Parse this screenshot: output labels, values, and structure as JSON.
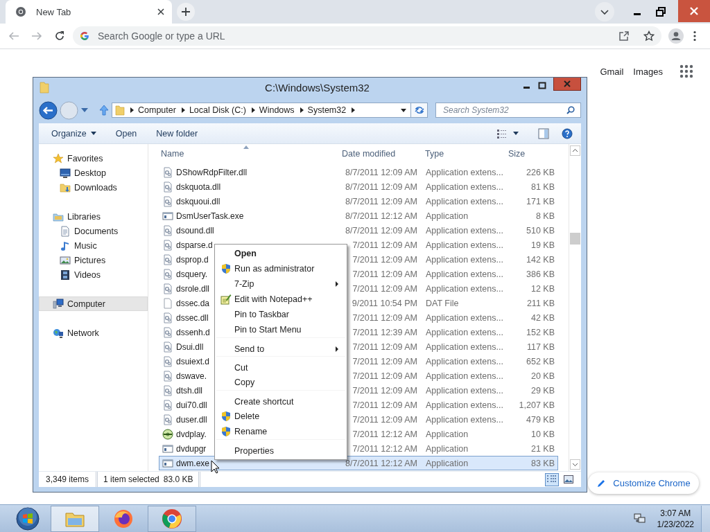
{
  "browser": {
    "tab": {
      "title": "New Tab"
    },
    "address_bar": {
      "placeholder": "Search Google or type a URL"
    },
    "links": [
      "Gmail",
      "Images"
    ],
    "customize_button": "Customize Chrome"
  },
  "explorer": {
    "title": "C:\\Windows\\System32",
    "breadcrumb": [
      "Computer",
      "Local Disk (C:)",
      "Windows",
      "System32"
    ],
    "search": {
      "placeholder": "Search System32"
    },
    "commands": [
      {
        "label": "Organize",
        "kind": "menu"
      },
      {
        "label": "Open",
        "kind": "plain"
      },
      {
        "label": "New folder",
        "kind": "plain"
      }
    ],
    "navigation": [
      {
        "label": "Favorites",
        "kind": "star",
        "selected": false,
        "children": [
          {
            "label": "Desktop",
            "kind": "desktop",
            "selected": false
          },
          {
            "label": "Downloads",
            "kind": "downloads",
            "selected": false
          }
        ]
      },
      {
        "label": "Libraries",
        "kind": "libraries",
        "selected": false,
        "children": [
          {
            "label": "Documents",
            "kind": "documents",
            "selected": false
          },
          {
            "label": "Music",
            "kind": "music",
            "selected": false
          },
          {
            "label": "Pictures",
            "kind": "pictures",
            "selected": false
          },
          {
            "label": "Videos",
            "kind": "videos",
            "selected": false
          }
        ]
      },
      {
        "label": "Computer",
        "kind": "computer",
        "selected": true
      },
      {
        "label": "Network",
        "kind": "network",
        "selected": false
      }
    ],
    "columns": [
      {
        "label": "Name",
        "sorted": true
      },
      {
        "label": "Date modified",
        "sorted": false
      },
      {
        "label": "Type",
        "sorted": false
      },
      {
        "label": "Size",
        "sorted": false
      }
    ],
    "files": [
      {
        "name": "DShowRdpFilter.dll",
        "date": "8/7/2011 12:09 AM",
        "type": "Application extens...",
        "size": "226 KB",
        "kind": "dll",
        "selected": false
      },
      {
        "name": "dskquota.dll",
        "date": "8/7/2011 12:09 AM",
        "type": "Application extens...",
        "size": "81 KB",
        "kind": "dll",
        "selected": false
      },
      {
        "name": "dskquoui.dll",
        "date": "8/7/2011 12:09 AM",
        "type": "Application extens...",
        "size": "171 KB",
        "kind": "dll",
        "selected": false
      },
      {
        "name": "DsmUserTask.exe",
        "date": "8/7/2011 12:12 AM",
        "type": "Application",
        "size": "8 KB",
        "kind": "exe",
        "selected": false
      },
      {
        "name": "dsound.dll",
        "date": "8/7/2011 12:09 AM",
        "type": "Application extens...",
        "size": "510 KB",
        "kind": "dll",
        "selected": false
      },
      {
        "name": "dsparse.d",
        "date": "7/2011 12:09 AM",
        "type": "Application extens...",
        "size": "19 KB",
        "kind": "dll",
        "selected": false
      },
      {
        "name": "dsprop.d",
        "date": "7/2011 12:09 AM",
        "type": "Application extens...",
        "size": "142 KB",
        "kind": "dll",
        "selected": false
      },
      {
        "name": "dsquery.",
        "date": "7/2011 12:09 AM",
        "type": "Application extens...",
        "size": "386 KB",
        "kind": "dll",
        "selected": false
      },
      {
        "name": "dsrole.dll",
        "date": "7/2011 12:09 AM",
        "type": "Application extens...",
        "size": "12 KB",
        "kind": "dll",
        "selected": false
      },
      {
        "name": "dssec.da",
        "date": "9/2011 10:54 PM",
        "type": "DAT File",
        "size": "211 KB",
        "kind": "dat",
        "selected": false
      },
      {
        "name": "dssec.dll",
        "date": "7/2011 12:09 AM",
        "type": "Application extens...",
        "size": "42 KB",
        "kind": "dll",
        "selected": false
      },
      {
        "name": "dssenh.d",
        "date": "7/2011 12:39 AM",
        "type": "Application extens...",
        "size": "152 KB",
        "kind": "dll",
        "selected": false
      },
      {
        "name": "Dsui.dll",
        "date": "7/2011 12:09 AM",
        "type": "Application extens...",
        "size": "117 KB",
        "kind": "dll",
        "selected": false
      },
      {
        "name": "dsuiext.d",
        "date": "7/2011 12:09 AM",
        "type": "Application extens...",
        "size": "652 KB",
        "kind": "dll",
        "selected": false
      },
      {
        "name": "dswave.",
        "date": "7/2011 12:09 AM",
        "type": "Application extens...",
        "size": "20 KB",
        "kind": "dll",
        "selected": false
      },
      {
        "name": "dtsh.dll",
        "date": "7/2011 12:09 AM",
        "type": "Application extens...",
        "size": "29 KB",
        "kind": "dll",
        "selected": false
      },
      {
        "name": "dui70.dll",
        "date": "7/2011 12:09 AM",
        "type": "Application extens...",
        "size": "1,207 KB",
        "kind": "dll",
        "selected": false
      },
      {
        "name": "duser.dll",
        "date": "7/2011 12:09 AM",
        "type": "Application extens...",
        "size": "479 KB",
        "kind": "dll",
        "selected": false
      },
      {
        "name": "dvdplay.",
        "date": "7/2011 12:12 AM",
        "type": "Application",
        "size": "10 KB",
        "kind": "dvd",
        "selected": false
      },
      {
        "name": "dvdupgr",
        "date": "7/2011 12:12 AM",
        "type": "Application",
        "size": "21 KB",
        "kind": "exe",
        "selected": false
      },
      {
        "name": "dwm.exe",
        "date": "8/7/2011 12:12 AM",
        "type": "Application",
        "size": "83 KB",
        "kind": "exe",
        "selected": true
      }
    ],
    "status": {
      "count": "3,349 items",
      "selection": "1 item selected",
      "selection_size": "83.0 KB"
    }
  },
  "context_menu": [
    {
      "label": "Open",
      "kind": "default",
      "submenu": false,
      "separator_before": false
    },
    {
      "label": "Run as administrator",
      "kind": "admin",
      "submenu": false,
      "separator_before": false
    },
    {
      "label": "7-Zip",
      "kind": "plain",
      "submenu": true,
      "separator_before": false
    },
    {
      "label": "Edit with Notepad++",
      "kind": "notepad",
      "submenu": false,
      "separator_before": false
    },
    {
      "label": "Pin to Taskbar",
      "kind": "plain",
      "submenu": false,
      "separator_before": false
    },
    {
      "label": "Pin to Start Menu",
      "kind": "plain",
      "submenu": false,
      "separator_before": false
    },
    {
      "label": "Send to",
      "kind": "plain",
      "submenu": true,
      "separator_before": true
    },
    {
      "label": "Cut",
      "kind": "plain",
      "submenu": false,
      "separator_before": true
    },
    {
      "label": "Copy",
      "kind": "plain",
      "submenu": false,
      "separator_before": false
    },
    {
      "label": "Create shortcut",
      "kind": "plain",
      "submenu": false,
      "separator_before": true
    },
    {
      "label": "Delete",
      "kind": "admin",
      "submenu": false,
      "separator_before": false
    },
    {
      "label": "Rename",
      "kind": "admin",
      "submenu": false,
      "separator_before": false
    },
    {
      "label": "Properties",
      "kind": "plain",
      "submenu": false,
      "separator_before": true
    }
  ],
  "taskbar": {
    "apps": [
      {
        "kind": "explorer",
        "open": true,
        "selected": true
      },
      {
        "kind": "firefox",
        "open": false,
        "selected": false
      },
      {
        "kind": "chrome",
        "open": true,
        "selected": false
      }
    ],
    "clock": {
      "time": "3:07 AM",
      "date": "1/23/2022"
    }
  }
}
